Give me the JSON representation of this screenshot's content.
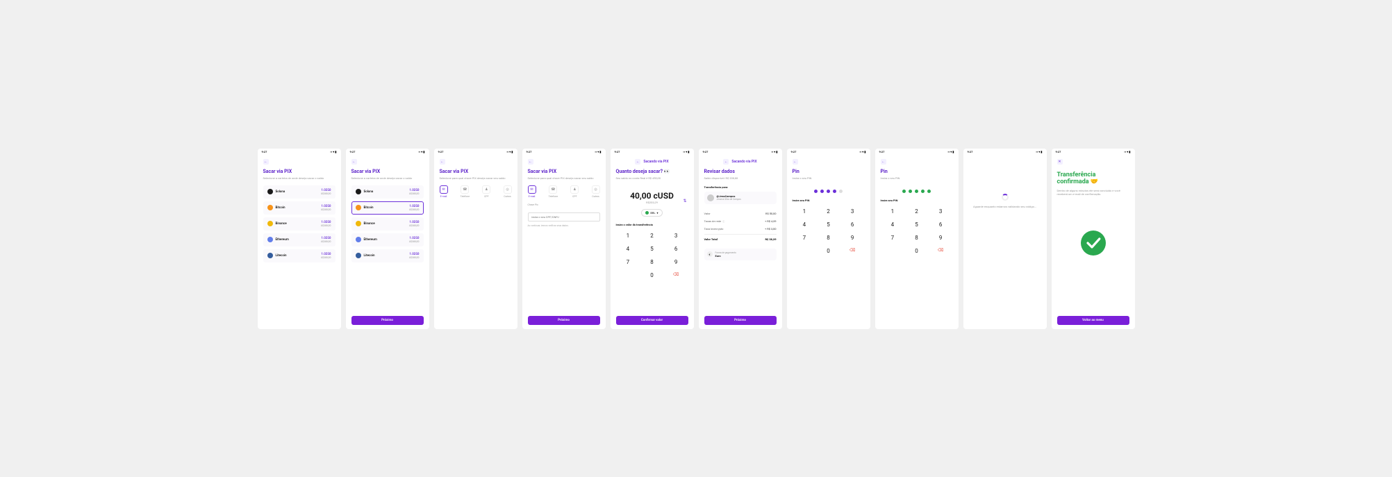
{
  "status": {
    "time": "9:27",
    "signal": "▪▪▪",
    "wifi": "▾",
    "battery": "▮"
  },
  "screen1": {
    "title": "Sacar via PIX",
    "subtitle": "Selecione a carteira de onde deseja sacar o saldo",
    "wallets": [
      {
        "name": "Solana",
        "val": "1.0250",
        "usd": "U$380,00",
        "color": "#1a1a1a"
      },
      {
        "name": "Bitcoin",
        "val": "1.0250",
        "usd": "U$380,00",
        "color": "#f7931a"
      },
      {
        "name": "Binance",
        "val": "1.0250",
        "usd": "U$380,00",
        "color": "#f0b90b"
      },
      {
        "name": "Ethereum",
        "val": "1.0250",
        "usd": "U$380,00",
        "color": "#627eea"
      },
      {
        "name": "Litecoin",
        "val": "1.0250",
        "usd": "U$380,00",
        "color": "#345d9d"
      }
    ]
  },
  "screen2": {
    "title": "Sacar via PIX",
    "subtitle": "Selecione a carteira de onde deseja sacar o saldo",
    "btn": "Próximo"
  },
  "screen3": {
    "title": "Sacar via PIX",
    "subtitle": "Selecione para qual chave PIX deseja sacar seu saldo",
    "types": [
      {
        "icon": "✉",
        "label": "E-mail"
      },
      {
        "icon": "☎",
        "label": "Telefone"
      },
      {
        "icon": "♟",
        "label": "CPF"
      },
      {
        "icon": "◎",
        "label": "Outros"
      }
    ]
  },
  "screen4": {
    "title": "Sacar via PIX",
    "subtitle": "Selecione para qual chave PIX deseja sacar seu saldo",
    "inputLabel": "Chave Pix",
    "placeholder": "Insira o seu CPF/CNPJ",
    "helper": "Ao continuar, iremos verificar seus dados.",
    "btn": "Próximo"
  },
  "screen5": {
    "header": "Sacando via PIX",
    "title": "Quanto deseja sacar?",
    "balance": "Seu saldo no conta Real é R$ 450,00",
    "amount": "40,00 cUSD",
    "amountSub": "R$203,29",
    "currency": "BRL",
    "kpTitle": "Insira o valor da transferência",
    "btn": "Confirmar valor"
  },
  "screen6": {
    "header": "Sacando via PIX",
    "title": "Revisar dados",
    "balance": "Saldo disponível: R$ 208,88",
    "section": "Transferência para:",
    "recipient": {
      "name": "@JessCampos",
      "sub": "Jessica Silva de Campos"
    },
    "fees": [
      {
        "label": "Valor",
        "val": "R$ 50,00"
      },
      {
        "label": "Taxas de rede",
        "val": "+ R$ 4,39",
        "info": true
      },
      {
        "label": "Taxa lovecrypto",
        "val": "+ R$ 3,00"
      }
    ],
    "total": {
      "label": "Valor Total",
      "val": "R$ 58,39"
    },
    "pm": {
      "label": "Forma de pagamento",
      "val": "Euro"
    },
    "btn": "Próximo"
  },
  "screen7": {
    "title": "Pin",
    "subtitle": "Insira o seu PIN",
    "label": "Insira seu PIN"
  },
  "screen8": {
    "title": "Pin",
    "subtitle": "Insira o seu PIN",
    "label": "Insira seu PIN"
  },
  "screen9": {
    "text": "Aguarde enquanto estamos validando seu código..."
  },
  "screen10": {
    "title": "Transferência confirmada 🤝",
    "subtitle": "Dentro de alguns minutos ele será concluído e você receberá um e-mail de confirmação.",
    "btn": "Voltar ao menu"
  },
  "keys": [
    "1",
    "2",
    "3",
    "4",
    "5",
    "6",
    "7",
    "8",
    "9",
    "",
    "0",
    "⌫"
  ]
}
